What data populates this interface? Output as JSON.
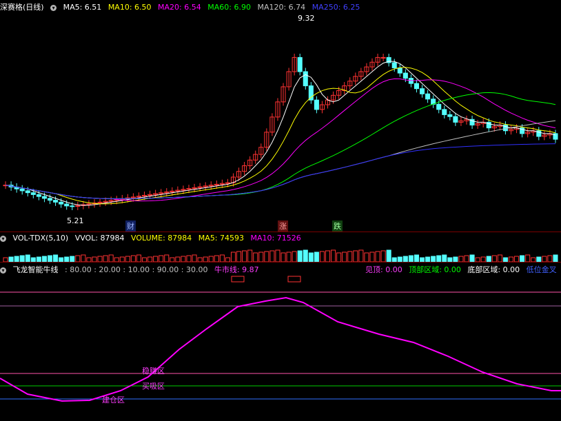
{
  "price_header": {
    "stock_name": "深赛格(日线)",
    "ma5": "MA5: 6.51",
    "ma10": "MA10: 6.50",
    "ma20": "MA20: 6.54",
    "ma60": "MA60: 6.90",
    "ma120": "MA120: 6.74",
    "ma250": "MA250: 6.25"
  },
  "price_annotations": {
    "high": "9.32",
    "low": "5.21"
  },
  "event_markers": {
    "cai": "财",
    "zhang": "涨",
    "die": "跌"
  },
  "vol_header": {
    "name": "VOL-TDX(5,10)",
    "vvol": "VVOL: 87984",
    "volume": "VOLUME: 87984",
    "ma5": "MA5: 74593",
    "ma10": "MA10: 71526"
  },
  "indicator_header": {
    "name": "飞龙智能牛线",
    "levels": ": 80.00 : 20.00 : 10.00 : 90.00 : 30.00",
    "bull_line": "牛市线: 9.87",
    "top_signal": "见顶: 0.00",
    "top_zone": "顶部区域: 0.00",
    "bottom_zone": "底部区域: 0.00",
    "low_gold_cross": "低位金叉"
  },
  "zone_labels": {
    "steady": "稳赚区",
    "buy": "买吸区",
    "bottom": "建仓区"
  },
  "colors": {
    "ma5": "#ffffff",
    "ma10": "#ffff00",
    "ma20": "#ff00ff",
    "ma60": "#00ff00",
    "ma120": "#c0c0c0",
    "ma250": "#3030ff",
    "up": "#ff3232",
    "down": "#54ffff",
    "bull_line": "#ff00ff"
  }
}
